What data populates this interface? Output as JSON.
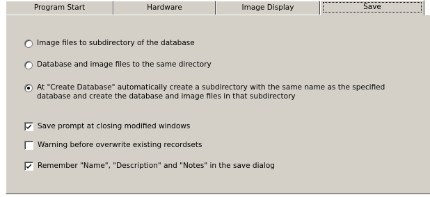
{
  "tabs": [
    {
      "label": "Program Start",
      "active": false
    },
    {
      "label": "Hardware",
      "active": false
    },
    {
      "label": "Image Display",
      "active": false
    },
    {
      "label": "Save",
      "active": true
    }
  ],
  "save_location": {
    "options": [
      {
        "label": "Image files to subdirectory of the database",
        "selected": false
      },
      {
        "label": "Database and image files to the same directory",
        "selected": false
      },
      {
        "label_lines": [
          "At \"Create Database\" automatically create a subdirectory with the same name as the specified",
          "database and create the database and image files in that subdirectory"
        ],
        "selected": true
      }
    ]
  },
  "checkboxes": [
    {
      "label": "Save prompt at closing modified windows",
      "checked": true
    },
    {
      "label": "Warning before overwrite existing recordsets",
      "checked": false
    },
    {
      "label": "Remember \"Name\", \"Description\" and \"Notes\" in the save dialog",
      "checked": true
    }
  ],
  "colors": {
    "face": "#d4d0c8",
    "highlight": "#ffffff",
    "shadow": "#808080",
    "dark_shadow": "#404040"
  }
}
